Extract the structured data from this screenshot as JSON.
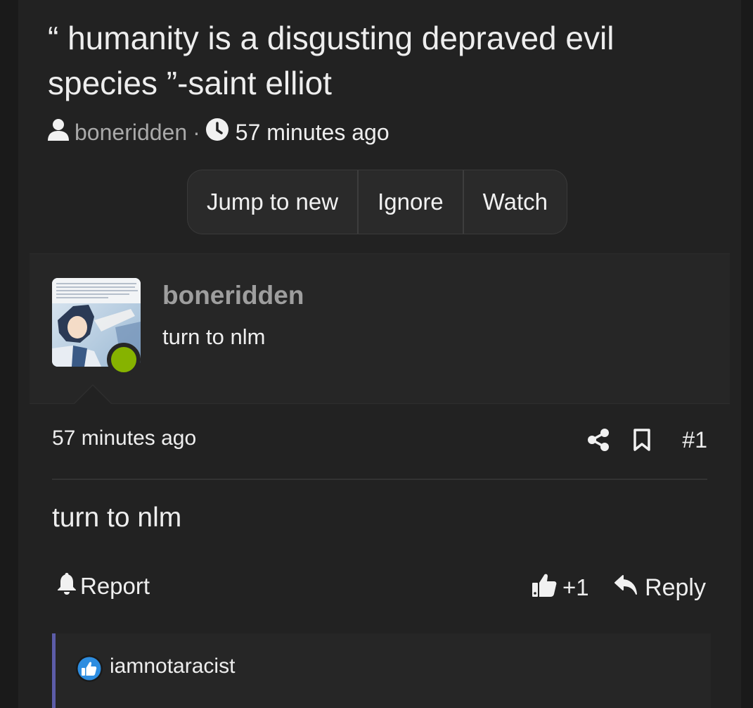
{
  "thread": {
    "title": "“ humanity is a disgusting depraved evil species ”-saint elliot",
    "author": "boneridden",
    "separator": "·",
    "time": "57 minutes ago"
  },
  "thread_buttons": {
    "jump_to_new": "Jump to new",
    "ignore": "Ignore",
    "watch": "Watch"
  },
  "post": {
    "author": "boneridden",
    "preview": "turn to nlm",
    "time": "57 minutes ago",
    "number": "#1",
    "body": "turn to nlm",
    "report_label": "Report",
    "like_count": "+1",
    "reply_label": "Reply",
    "online_color": "#86b300"
  },
  "reactions": {
    "user": "iamnotaracist",
    "bar_accent": "#5c5ca8",
    "icon": "thumbs-up-badge-icon",
    "icon_color": "#2d8de0"
  }
}
